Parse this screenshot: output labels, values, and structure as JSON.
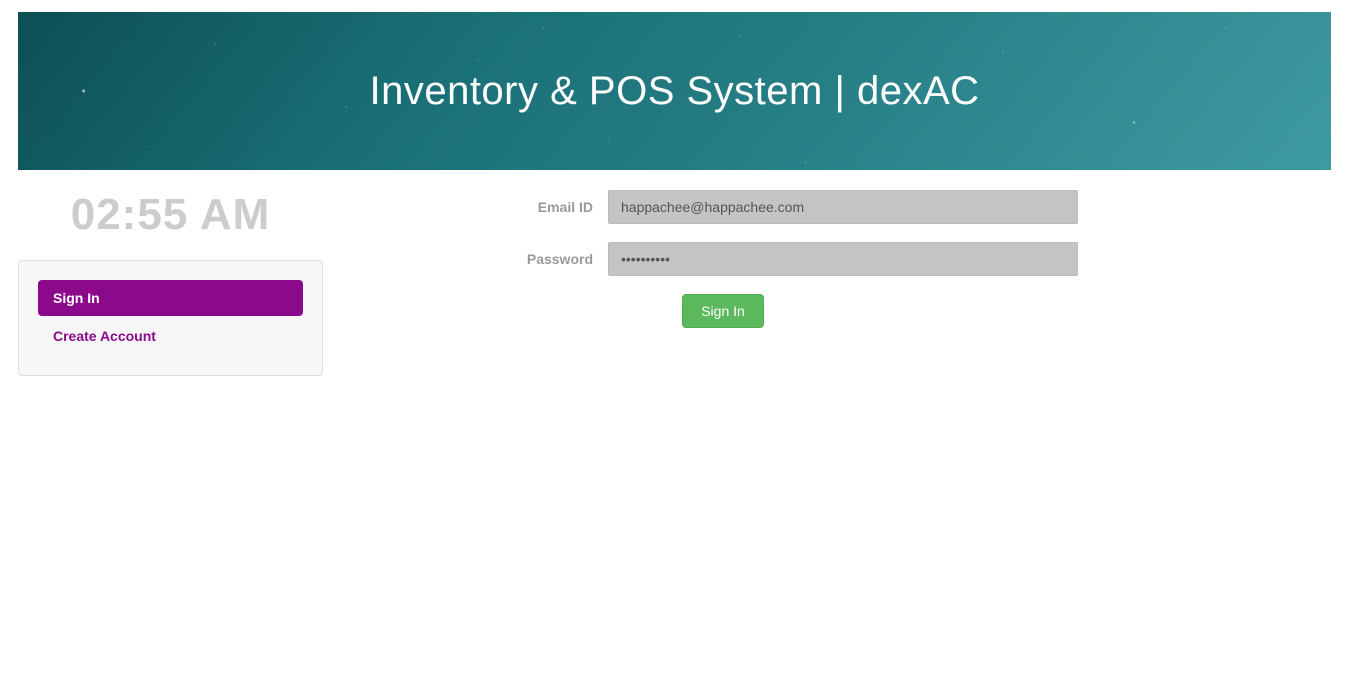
{
  "header": {
    "title": "Inventory & POS System | dexAC"
  },
  "clock": {
    "time": "02:55 AM"
  },
  "nav": {
    "signin_label": "Sign In",
    "create_account_label": "Create Account"
  },
  "form": {
    "email_label": "Email ID",
    "email_value": "happachee@happachee.com",
    "password_label": "Password",
    "password_value": "••••••••••",
    "submit_label": "Sign In"
  }
}
